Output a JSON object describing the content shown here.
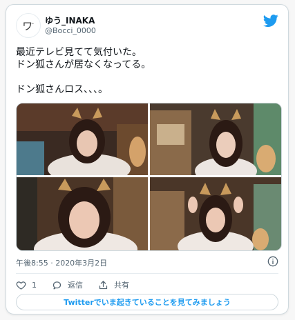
{
  "user": {
    "display_name": "ゆう_INAKA",
    "handle": "@Bocci_0000",
    "avatar_icon": "hand-drawn-avatar"
  },
  "brand_icon": "twitter-bird-icon",
  "colors": {
    "accent": "#1d9bf0",
    "text": "#0f1419",
    "muted": "#536471",
    "border": "#cfd9de"
  },
  "tweet": {
    "text": "最近テレビ見てて気付いた。\nドン狐さんが居なくなってる。\n\nドン狐さんロス、、、。"
  },
  "timestamp": "午後8:55 · 2020年3月2日",
  "actions": {
    "like_count": "1",
    "reply_label": "返信",
    "share_label": "共有"
  },
  "cta_label": "Twitterでいま起きていることを見てみましょう"
}
